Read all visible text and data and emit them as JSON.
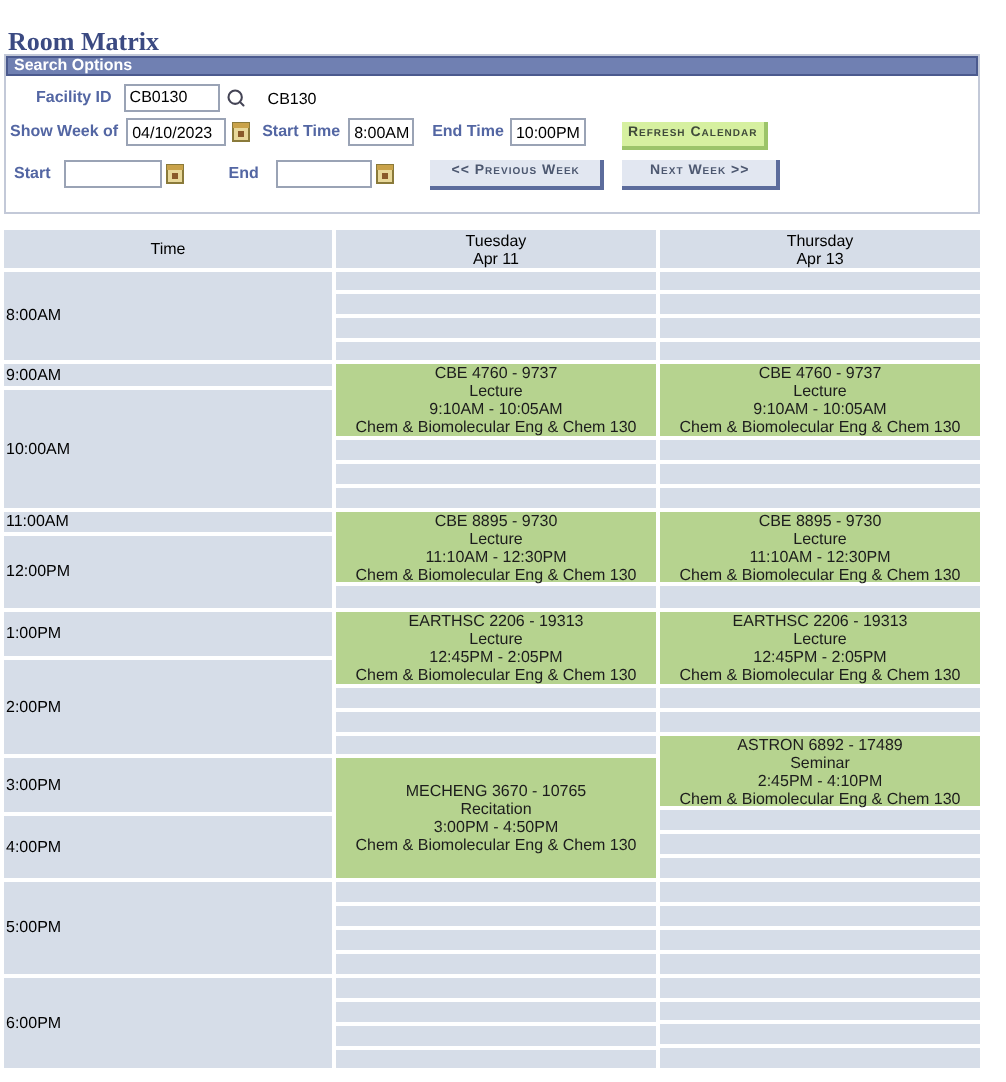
{
  "title": "Room Matrix",
  "search_options": {
    "header": "Search Options",
    "facility_id": {
      "label": "Facility ID",
      "value": "CB0130",
      "description": "CB130"
    },
    "show_week_of": {
      "label": "Show Week of",
      "value": "04/10/2023"
    },
    "start_time": {
      "label": "Start Time",
      "value": "8:00AM"
    },
    "end_time": {
      "label": "End Time",
      "value": "10:00PM"
    },
    "refresh_button": "Refresh Calendar",
    "start": {
      "label": "Start"
    },
    "end": {
      "label": "End"
    },
    "previous_button": "<< Previous Week",
    "next_button": "Next Week >>"
  },
  "calendar": {
    "time_header": "Time",
    "times": [
      "8:00AM",
      "9:00AM",
      "10:00AM",
      "11:00AM",
      "12:00PM",
      "1:00PM",
      "2:00PM",
      "3:00PM",
      "4:00PM",
      "5:00PM",
      "6:00PM"
    ],
    "days": [
      {
        "day": "Tuesday",
        "date": "Apr 11",
        "slots": [
          {
            "kind": "empty"
          },
          {
            "kind": "empty"
          },
          {
            "kind": "empty"
          },
          {
            "kind": "empty"
          },
          {
            "kind": "event",
            "course": "CBE 4760 - 9737",
            "type": "Lecture",
            "time": "9:10AM - 10:05AM",
            "room": "Chem & Biomolecular Eng & Chem 130"
          },
          {
            "kind": "empty"
          },
          {
            "kind": "empty"
          },
          {
            "kind": "empty"
          },
          {
            "kind": "event",
            "course": "CBE 8895 - 9730",
            "type": "Lecture",
            "time": "11:10AM - 12:30PM",
            "room": "Chem & Biomolecular Eng & Chem 130"
          },
          {
            "kind": "empty"
          },
          {
            "kind": "event",
            "course": "EARTHSC 2206 - 19313",
            "type": "Lecture",
            "time": "12:45PM - 2:05PM",
            "room": "Chem & Biomolecular Eng & Chem 130"
          },
          {
            "kind": "empty"
          },
          {
            "kind": "empty"
          },
          {
            "kind": "empty"
          },
          {
            "kind": "event",
            "course": "MECHENG 3670 - 10765",
            "type": "Recitation",
            "time": "3:00PM - 4:50PM",
            "room": "Chem & Biomolecular Eng & Chem 130"
          },
          {
            "kind": "empty"
          },
          {
            "kind": "empty"
          },
          {
            "kind": "empty"
          },
          {
            "kind": "empty"
          },
          {
            "kind": "empty"
          },
          {
            "kind": "empty"
          },
          {
            "kind": "empty"
          },
          {
            "kind": "empty"
          }
        ]
      },
      {
        "day": "Thursday",
        "date": "Apr 13",
        "slots": [
          {
            "kind": "empty"
          },
          {
            "kind": "empty"
          },
          {
            "kind": "empty"
          },
          {
            "kind": "empty"
          },
          {
            "kind": "event",
            "course": "CBE 4760 - 9737",
            "type": "Lecture",
            "time": "9:10AM - 10:05AM",
            "room": "Chem & Biomolecular Eng & Chem 130"
          },
          {
            "kind": "empty"
          },
          {
            "kind": "empty"
          },
          {
            "kind": "empty"
          },
          {
            "kind": "event",
            "course": "CBE 8895 - 9730",
            "type": "Lecture",
            "time": "11:10AM - 12:30PM",
            "room": "Chem & Biomolecular Eng & Chem 130"
          },
          {
            "kind": "empty"
          },
          {
            "kind": "event",
            "course": "EARTHSC 2206 - 19313",
            "type": "Lecture",
            "time": "12:45PM - 2:05PM",
            "room": "Chem & Biomolecular Eng & Chem 130"
          },
          {
            "kind": "empty"
          },
          {
            "kind": "empty"
          },
          {
            "kind": "event",
            "course": "ASTRON 6892 - 17489",
            "type": "Seminar",
            "time": "2:45PM - 4:10PM",
            "room": "Chem & Biomolecular Eng & Chem 130"
          },
          {
            "kind": "empty"
          },
          {
            "kind": "empty"
          },
          {
            "kind": "empty"
          },
          {
            "kind": "empty"
          },
          {
            "kind": "empty"
          },
          {
            "kind": "empty"
          },
          {
            "kind": "empty"
          },
          {
            "kind": "empty"
          },
          {
            "kind": "empty"
          },
          {
            "kind": "empty"
          },
          {
            "kind": "empty"
          }
        ]
      }
    ]
  }
}
